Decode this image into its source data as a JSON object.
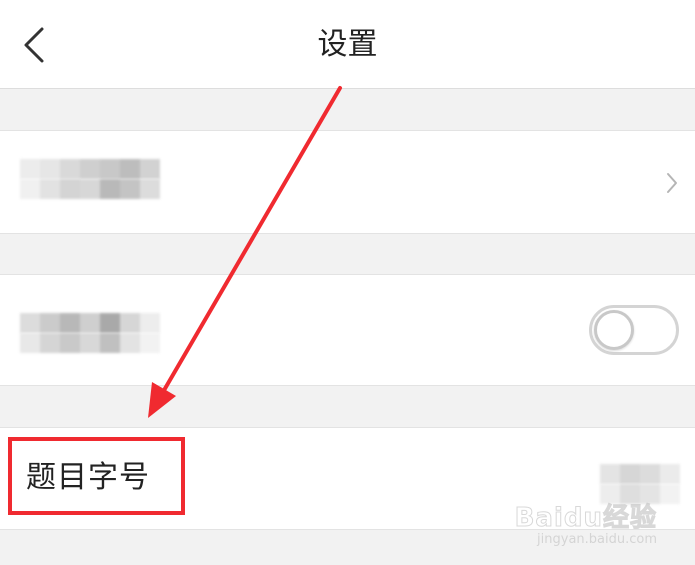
{
  "header": {
    "title": "设置",
    "back_icon": "chevron-left-icon"
  },
  "rows": [
    {
      "label": "",
      "label_obscured": true,
      "accessory": "chevron-right-icon"
    },
    {
      "label": "",
      "label_obscured": true,
      "accessory": "toggle",
      "toggle_on": false
    },
    {
      "label": "题目字号",
      "value_obscured": true,
      "highlighted": true
    }
  ],
  "annotation": {
    "arrow_color": "#f02a30",
    "highlight_color": "#f02a30"
  },
  "watermark": {
    "logo": "Baidu经验",
    "url": "jingyan.baidu.com"
  }
}
